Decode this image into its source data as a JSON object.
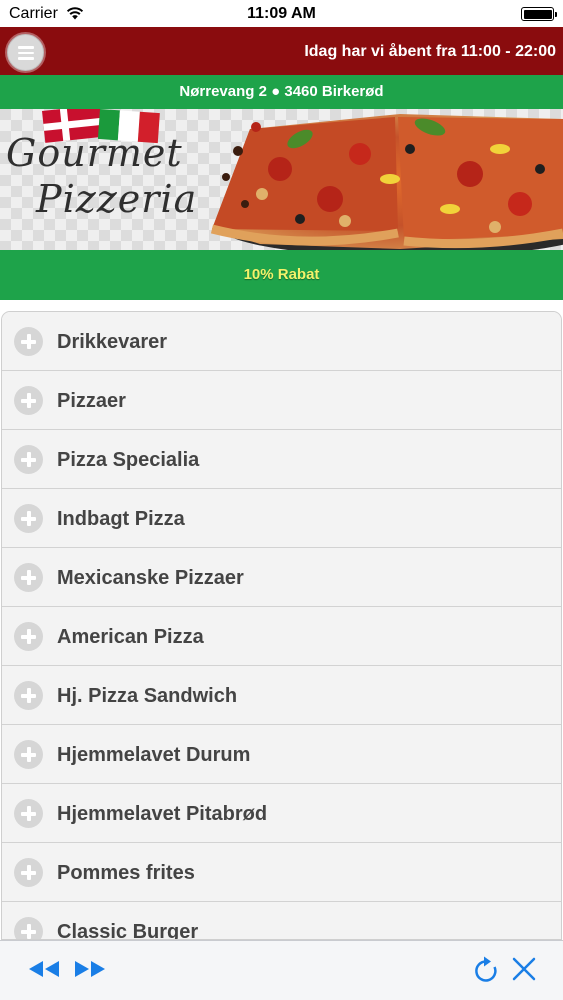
{
  "status_bar": {
    "carrier": "Carrier",
    "time": "11:09 AM"
  },
  "header": {
    "menu_icon": "hamburger-menu-icon",
    "opening_hours": "Idag har vi åbent fra 11:00 - 22:00",
    "background_color": "#8a0c0e"
  },
  "address": {
    "text": "Nørrevang 2 ● 3460 Birkerød",
    "background_color": "#1ea34a"
  },
  "banner": {
    "brand_line_1": "Gourmet",
    "brand_line_2": "Pizzeria"
  },
  "promo": {
    "text": "10% Rabat",
    "text_color": "#f2f26a"
  },
  "menu": {
    "items": [
      {
        "label": "Drikkevarer"
      },
      {
        "label": "Pizzaer"
      },
      {
        "label": "Pizza Specialia"
      },
      {
        "label": "Indbagt Pizza"
      },
      {
        "label": "Mexicanske Pizzaer"
      },
      {
        "label": "American Pizza"
      },
      {
        "label": "Hj. Pizza Sandwich"
      },
      {
        "label": "Hjemmelavet Durum"
      },
      {
        "label": "Hjemmelavet Pitabrød"
      },
      {
        "label": "Pommes frites"
      },
      {
        "label": "Classic Burger"
      }
    ]
  },
  "toolbar": {
    "back_icon": "rewind-icon",
    "forward_icon": "fast-forward-icon",
    "refresh_icon": "refresh-icon",
    "close_icon": "close-icon",
    "accent_color": "#1a7ee6"
  }
}
